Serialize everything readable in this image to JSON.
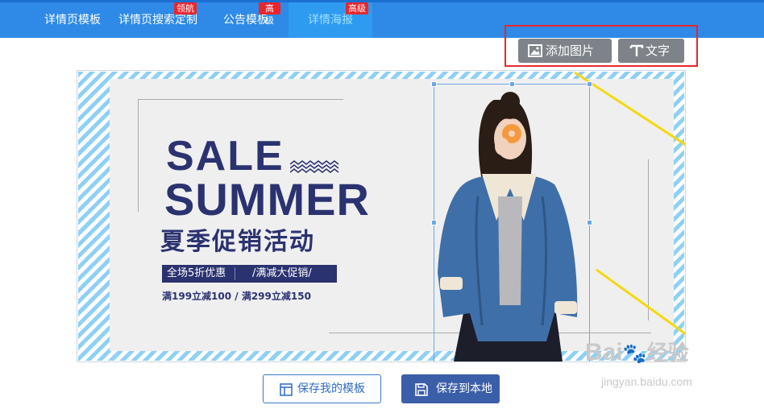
{
  "nav": {
    "tabs": [
      {
        "label": "详情页模板",
        "badge": ""
      },
      {
        "label": "详情页搜索定制",
        "badge": "领航"
      },
      {
        "label": "公告模板",
        "badge": "高级"
      },
      {
        "label": "详情海报",
        "badge": "高级"
      }
    ]
  },
  "toolbar": {
    "add_image_label": "添加图片",
    "add_text_label": "文字",
    "add_image_icon": "image-icon",
    "add_text_icon": "text-icon"
  },
  "poster": {
    "line1": "SALE",
    "line2": "SUMMER",
    "cn_title": "夏季促销活动",
    "promo_left": "全场5折优惠",
    "promo_right": "/满减大促销/",
    "promo_line": "满199立减100 / 满299立减150",
    "colors": {
      "navy": "#2b3270",
      "stripe": "#8fd0f4",
      "accent_yellow": "#f5d80f",
      "selection": "#6aa7ee"
    }
  },
  "actions": {
    "save_template_label": "保存我的模板",
    "save_local_label": "保存到本地",
    "save_template_icon": "template-icon",
    "save_local_icon": "floppy-icon"
  },
  "watermark": {
    "brand": "Bai",
    "brand_cn": "经验",
    "url": "jingyan.baidu.com"
  }
}
